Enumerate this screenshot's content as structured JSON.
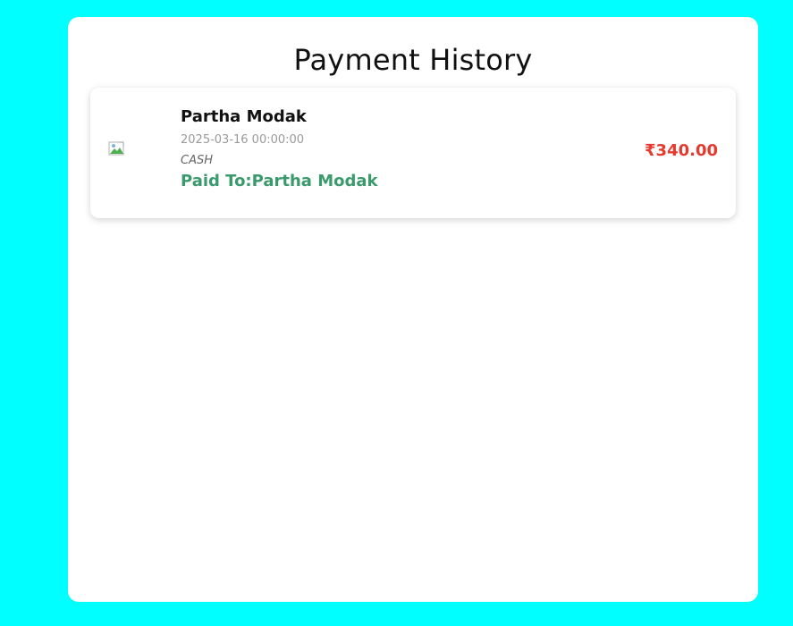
{
  "page": {
    "title": "Payment History"
  },
  "payments": [
    {
      "name": "Partha Modak",
      "datetime": "2025-03-16 00:00:00",
      "method": "CASH",
      "paid_to": "Paid To:Partha Modak",
      "amount": "₹340.00",
      "image_icon": "broken-image-icon"
    }
  ],
  "colors": {
    "background": "#00ffff",
    "panel": "#ffffff",
    "amount": "#e63a2e",
    "paid_to": "#3a9a6b",
    "date": "#9a9a9a"
  }
}
